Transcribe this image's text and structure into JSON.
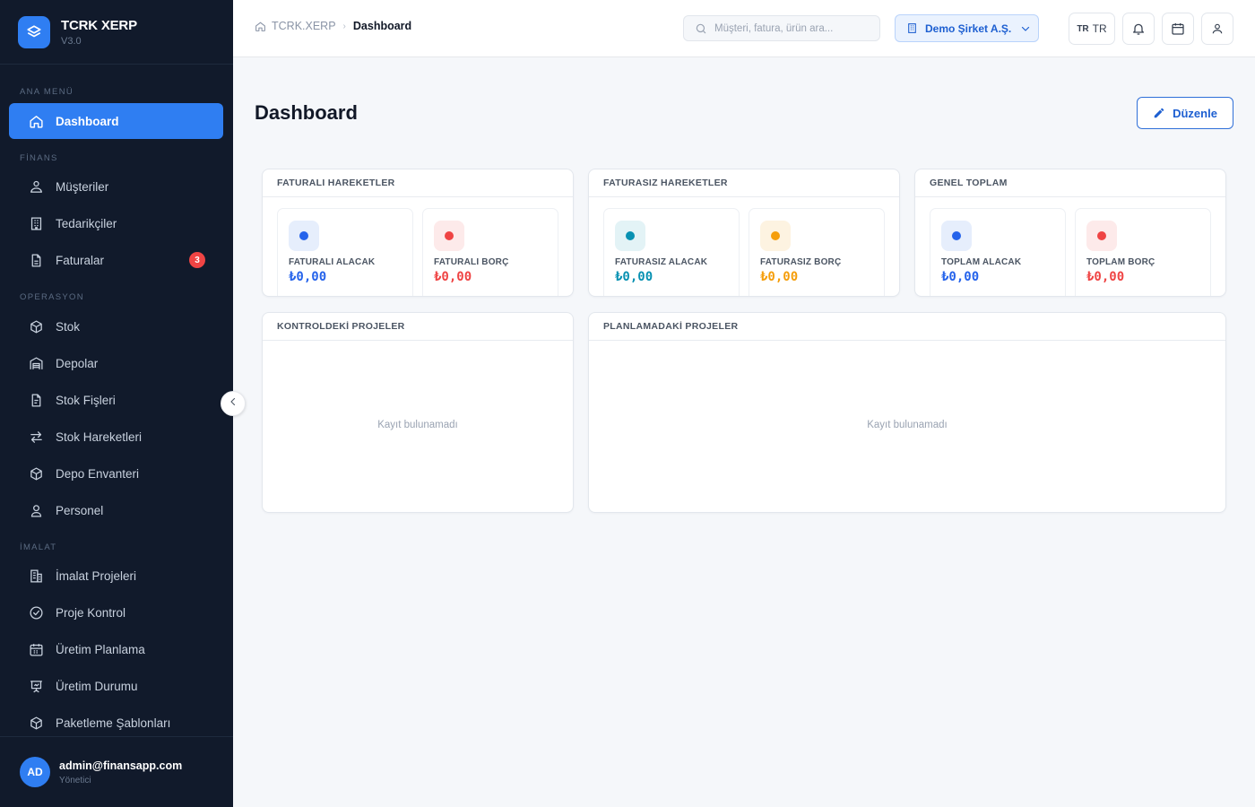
{
  "brand": {
    "name": "TCRK XERP",
    "version": "V3.0"
  },
  "sidebar": {
    "sections": [
      "ANA MENÜ",
      "FİNANS",
      "OPERASYON",
      "İMALAT"
    ],
    "items": [
      {
        "label": "Dashboard",
        "icon": "home-icon",
        "active": true
      },
      {
        "label": "Müşteriler",
        "icon": "users-icon"
      },
      {
        "label": "Tedarikçiler",
        "icon": "building-icon"
      },
      {
        "label": "Faturalar",
        "icon": "document-icon",
        "badge": "3"
      },
      {
        "label": "Stok",
        "icon": "box-icon"
      },
      {
        "label": "Depolar",
        "icon": "warehouse-icon"
      },
      {
        "label": "Stok Fişleri",
        "icon": "receipt-icon"
      },
      {
        "label": "Stok Hareketleri",
        "icon": "transfer-icon"
      },
      {
        "label": "Depo Envanteri",
        "icon": "cube-icon"
      },
      {
        "label": "Personel",
        "icon": "person-icon"
      },
      {
        "label": "İmalat Projeleri",
        "icon": "factory-icon"
      },
      {
        "label": "Proje Kontrol",
        "icon": "check-circle-icon"
      },
      {
        "label": "Üretim Planlama",
        "icon": "calendar-grid-icon"
      },
      {
        "label": "Üretim Durumu",
        "icon": "presentation-icon"
      },
      {
        "label": "Paketleme Şablonları",
        "icon": "package-icon"
      }
    ],
    "user": {
      "initials": "AD",
      "email": "admin@finansapp.com",
      "role": "Yönetici"
    }
  },
  "header": {
    "breadcrumb": [
      "TCRK.XERP",
      "Dashboard"
    ],
    "search_placeholder": "Müşteri, fatura, ürün ara...",
    "company": "Demo Şirket A.Ş.",
    "lang_flag": "TR",
    "lang_code": "TR"
  },
  "main": {
    "title": "Dashboard",
    "edit_label": "Düzenle",
    "panels": [
      {
        "title": "FATURALI HAREKETLER",
        "stats": [
          {
            "label": "FATURALI ALACAK",
            "value": "₺0,00",
            "color": "#2563eb",
            "bg": "#e6eefc"
          },
          {
            "label": "FATURALI BORÇ",
            "value": "₺0,00",
            "color": "#ef4444",
            "bg": "#fdeaea"
          }
        ]
      },
      {
        "title": "FATURASIZ HAREKETLER",
        "stats": [
          {
            "label": "FATURASIZ ALACAK",
            "value": "₺0,00",
            "color": "#0891b2",
            "bg": "#e3f3f6"
          },
          {
            "label": "FATURASIZ BORÇ",
            "value": "₺0,00",
            "color": "#f59e0b",
            "bg": "#fdf3e1"
          }
        ]
      },
      {
        "title": "GENEL TOPLAM",
        "stats": [
          {
            "label": "TOPLAM ALACAK",
            "value": "₺0,00",
            "color": "#2563eb",
            "bg": "#e6eefc"
          },
          {
            "label": "TOPLAM BORÇ",
            "value": "₺0,00",
            "color": "#ef4444",
            "bg": "#fdeaea"
          }
        ]
      }
    ],
    "projects": [
      {
        "title": "KONTROLDEKİ PROJELER",
        "empty": "Kayıt bulunamadı"
      },
      {
        "title": "PLANLAMADAKİ PROJELER",
        "empty": "Kayıt bulunamadı"
      }
    ]
  }
}
